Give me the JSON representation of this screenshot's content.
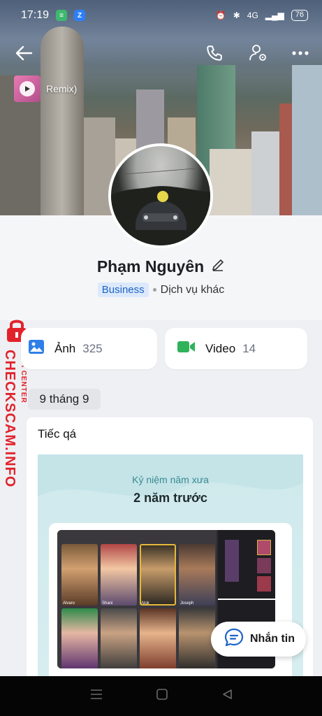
{
  "status_bar": {
    "time": "17:19",
    "battery": "76",
    "network": "4G"
  },
  "music": {
    "title": "Remix)"
  },
  "profile": {
    "name": "Phạm Nguyên",
    "badge": "Business",
    "category": "Dịch vụ khác"
  },
  "watermark": {
    "brand": "CHECKSCAM.INFO",
    "sub": "DATA CENTER"
  },
  "media": {
    "photos": {
      "label": "Ảnh",
      "count": "325"
    },
    "videos": {
      "label": "Video",
      "count": "14"
    }
  },
  "post": {
    "date": "9 tháng 9",
    "text": "Tiếc qá",
    "memory_subtitle": "Kỷ niệm năm xưa",
    "memory_title": "2 năm trước",
    "game_names": [
      "Alvaro",
      "Shani",
      "Alok",
      "Joseph"
    ]
  },
  "chat_button": {
    "label": "Nhắn tin"
  },
  "colors": {
    "accent": "#1e62c8",
    "video_green": "#2fb25a",
    "watermark_red": "#e2222b"
  }
}
